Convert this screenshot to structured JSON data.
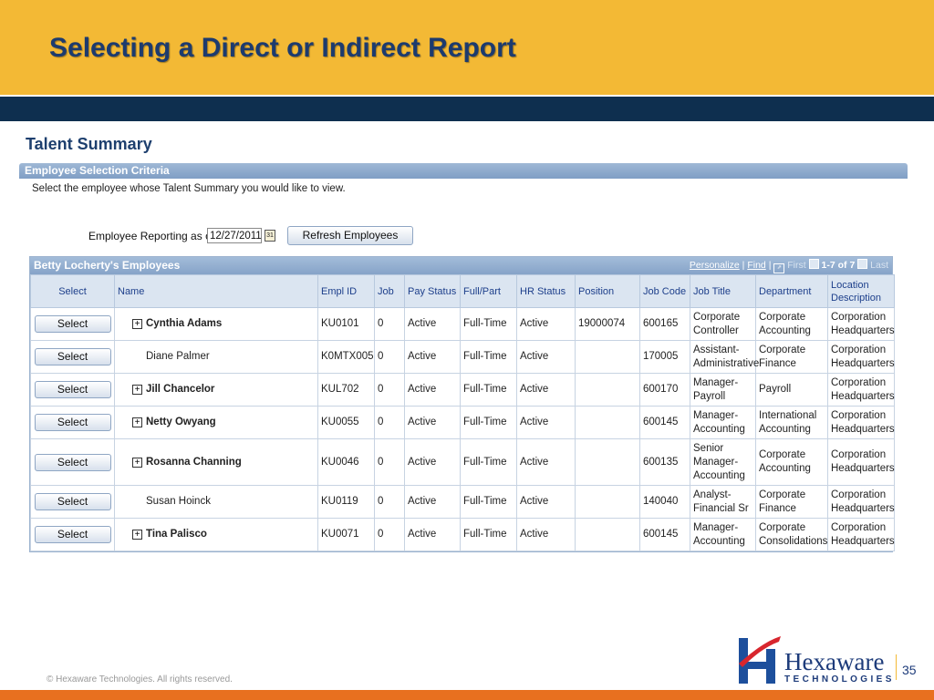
{
  "slide": {
    "title": "Selecting a Direct or Indirect Report",
    "footer": "© Hexaware Technologies. All rights reserved.",
    "page_number": "35",
    "logo_text": "Hexaware",
    "logo_subtext": "TECHNOLOGIES",
    "colors": {
      "header": "#f3b935",
      "band": "#0e2f4f",
      "bottom_bar": "#e8701f",
      "grid_header": "#86a3c8"
    }
  },
  "page": {
    "title": "Talent Summary",
    "section_title": "Employee Selection Criteria",
    "instruction": "Select the employee whose Talent Summary you would like to view.",
    "reporting_label": "Employee Reporting as of",
    "reporting_date": "12/27/2011",
    "calendar_icon": "calendar-icon",
    "refresh_label": "Refresh Employees"
  },
  "grid": {
    "caption": "Betty Locherty's Employees",
    "nav": {
      "personalize": "Personalize",
      "separator": "|",
      "find": "Find",
      "first": "First",
      "range": "1-7 of 7",
      "last": "Last"
    },
    "columns": [
      "Select",
      "Name",
      "Empl ID",
      "Job",
      "Pay Status",
      "Full/Part",
      "HR Status",
      "Position",
      "Job Code",
      "Job Title",
      "Department",
      "Location Description"
    ],
    "select_label": "Select",
    "rows": [
      {
        "name": "Cynthia Adams",
        "expandable": true,
        "empl_id": "KU0101",
        "job": "0",
        "pay_status": "Active",
        "full_part": "Full-Time",
        "hr_status": "Active",
        "position": "19000074",
        "job_code": "600165",
        "job_title": "Corporate Controller",
        "department": "Corporate Accounting",
        "location": "Corporation Headquarters"
      },
      {
        "name": "Diane Palmer",
        "expandable": false,
        "empl_id": "K0MTX005",
        "job": "0",
        "pay_status": "Active",
        "full_part": "Full-Time",
        "hr_status": "Active",
        "position": "",
        "job_code": "170005",
        "job_title": "Assistant-Administrative",
        "department": "Corporate Finance",
        "location": "Corporation Headquarters"
      },
      {
        "name": "Jill Chancelor",
        "expandable": true,
        "empl_id": "KUL702",
        "job": "0",
        "pay_status": "Active",
        "full_part": "Full-Time",
        "hr_status": "Active",
        "position": "",
        "job_code": "600170",
        "job_title": "Manager-Payroll",
        "department": "Payroll",
        "location": "Corporation Headquarters"
      },
      {
        "name": "Netty Owyang",
        "expandable": true,
        "empl_id": "KU0055",
        "job": "0",
        "pay_status": "Active",
        "full_part": "Full-Time",
        "hr_status": "Active",
        "position": "",
        "job_code": "600145",
        "job_title": "Manager-Accounting",
        "department": "International Accounting",
        "location": "Corporation Headquarters"
      },
      {
        "name": "Rosanna Channing",
        "expandable": true,
        "empl_id": "KU0046",
        "job": "0",
        "pay_status": "Active",
        "full_part": "Full-Time",
        "hr_status": "Active",
        "position": "",
        "job_code": "600135",
        "job_title": "Senior Manager-Accounting",
        "department": "Corporate Accounting",
        "location": "Corporation Headquarters"
      },
      {
        "name": "Susan Hoinck",
        "expandable": false,
        "empl_id": "KU0119",
        "job": "0",
        "pay_status": "Active",
        "full_part": "Full-Time",
        "hr_status": "Active",
        "position": "",
        "job_code": "140040",
        "job_title": "Analyst-Financial Sr",
        "department": "Corporate Finance",
        "location": "Corporation Headquarters"
      },
      {
        "name": "Tina Palisco",
        "expandable": true,
        "empl_id": "KU0071",
        "job": "0",
        "pay_status": "Active",
        "full_part": "Full-Time",
        "hr_status": "Active",
        "position": "",
        "job_code": "600145",
        "job_title": "Manager-Accounting",
        "department": "Corporate Consolidations",
        "location": "Corporation Headquarters"
      }
    ]
  }
}
